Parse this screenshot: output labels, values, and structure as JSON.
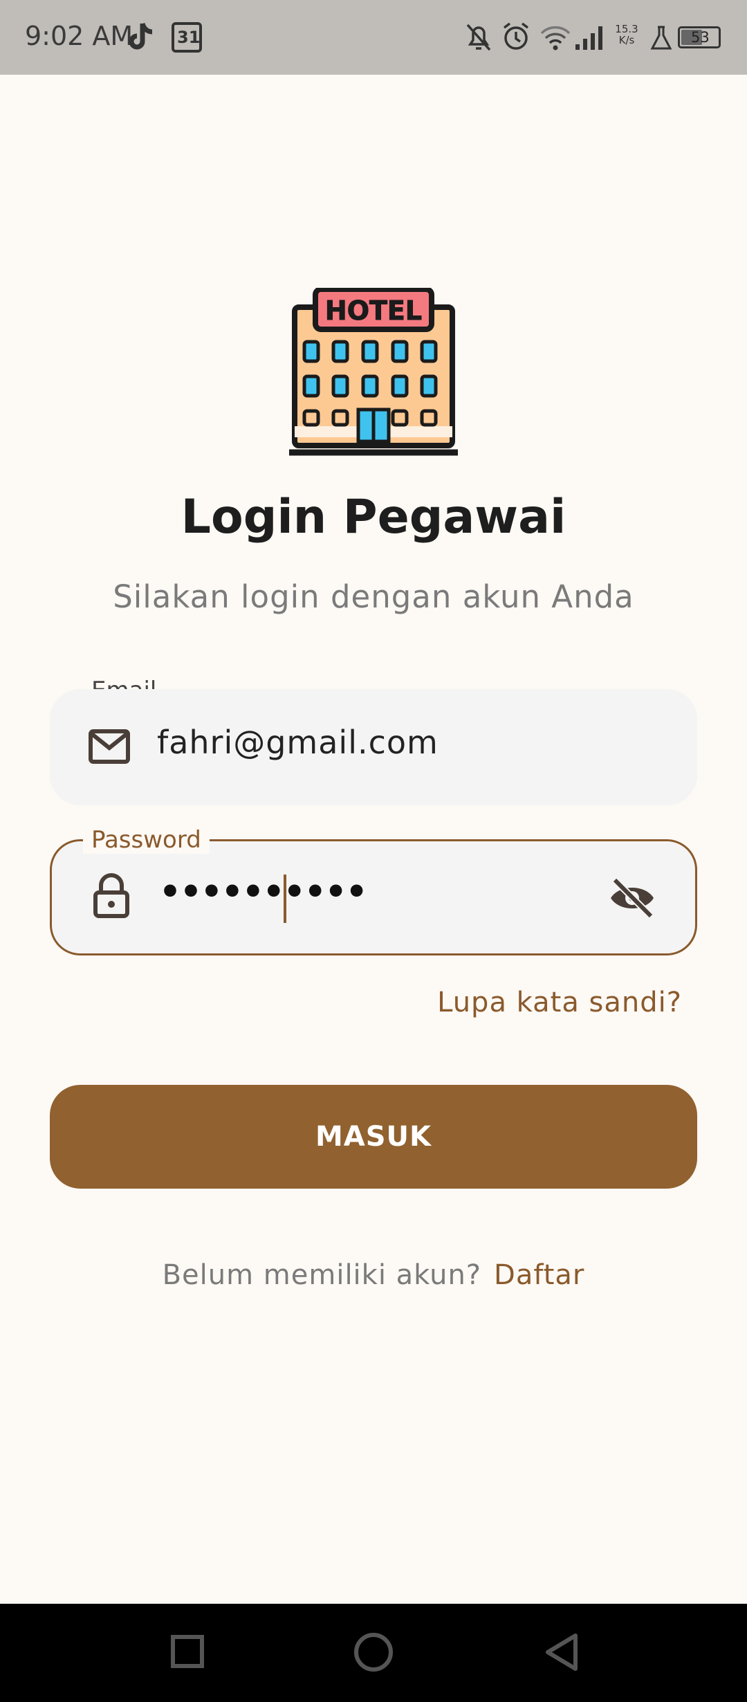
{
  "status_bar": {
    "time": "9:02 AM",
    "calendar_day": "31",
    "network_speed_value": "15.3",
    "network_speed_unit": "K/s",
    "battery": "53"
  },
  "app": {
    "title": "Login Pegawai",
    "subtitle": "Silakan login dengan akun Anda",
    "logo_text": "HOTEL"
  },
  "email": {
    "label": "Email",
    "value": "fahri@gmail.com"
  },
  "password": {
    "label": "Password",
    "masked_value": "••••••••••"
  },
  "forgot_password": "Lupa kata sandi?",
  "login_button": "MASUK",
  "register": {
    "prompt": "Belum memiliki akun?",
    "link": "Daftar"
  },
  "colors": {
    "accent": "#91612f",
    "background": "#fdf9f5",
    "field_bg": "#f4f4f4"
  },
  "icons": {
    "status": [
      "tiktok-icon",
      "calendar-icon",
      "bell-off-icon",
      "alarm-icon",
      "wifi-icon",
      "signal-icon",
      "flask-icon",
      "battery-icon"
    ],
    "fields": [
      "mail-icon",
      "lock-icon",
      "eye-off-icon"
    ],
    "nav": [
      "recents-square-icon",
      "home-circle-icon",
      "back-triangle-icon"
    ]
  }
}
